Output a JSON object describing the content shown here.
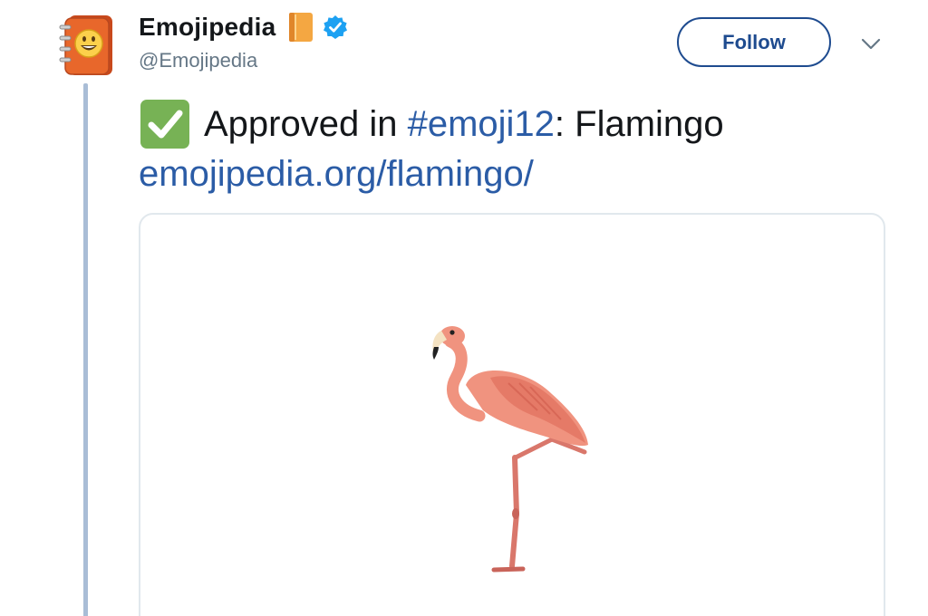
{
  "account": {
    "display_name": "Emojipedia",
    "handle": "@Emojipedia",
    "verified": true
  },
  "actions": {
    "follow_label": "Follow"
  },
  "tweet": {
    "text_before_hashtag": "Approved in ",
    "hashtag": "#emoji12",
    "text_after_hashtag": ": Flamingo",
    "link": "emojipedia.org/flamingo/"
  },
  "icons": {
    "avatar": "emojipedia-logo-icon",
    "name_suffix": "orange-book-icon",
    "verified": "verified-badge-icon",
    "tweet_prefix": "check-mark-button-icon",
    "menu": "chevron-down-icon",
    "media": "flamingo-emoji-image"
  },
  "colors": {
    "link": "#2b5ca6",
    "follow_border": "#1e4b8f",
    "thread_line": "#a9bdd6",
    "verified": "#1da1f2",
    "check_green": "#77b255"
  }
}
